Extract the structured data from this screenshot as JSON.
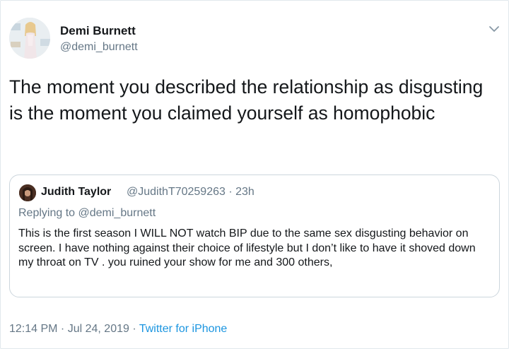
{
  "author": {
    "display_name": "Demi Burnett",
    "handle": "@demi_burnett"
  },
  "tweet": {
    "text": "The moment you described the relationship as disgusting is the moment you claimed yourself as homophobic"
  },
  "quoted_tweet": {
    "display_name": "Judith Taylor",
    "handle": "@JudithT70259263",
    "separator": " · ",
    "time": "23h",
    "reply_prefix": "Replying to ",
    "reply_mention": "@demi_burnett",
    "text": "This is the first season I WILL NOT watch BIP due to the same sex disgusting behavior on screen. I have nothing against their choice of lifestyle but I don’t like to have it shoved down my throat on TV . you ruined your  show for me and 300 others,"
  },
  "footer": {
    "time": "12:14 PM",
    "separator1": " · ",
    "date": "Jul 24, 2019",
    "separator2": " · ",
    "source": "Twitter for iPhone"
  },
  "icons": {
    "caret": "chevron-down-icon"
  },
  "colors": {
    "text_primary": "#14171a",
    "text_secondary": "#657786",
    "link": "#1b95e0",
    "border": "#ccd6dd"
  }
}
